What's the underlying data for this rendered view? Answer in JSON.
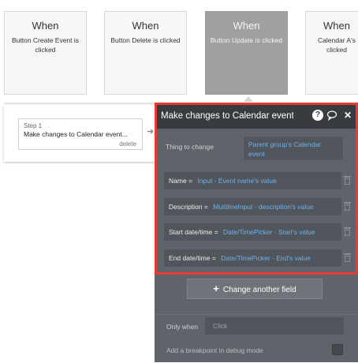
{
  "events": [
    {
      "when": "When",
      "description": "Button Create Event is clicked"
    },
    {
      "when": "When",
      "description": "Button Delete is clicked"
    },
    {
      "when": "When",
      "description": "Button Update is clicked"
    },
    {
      "when": "When",
      "description": "Calendar A's",
      "description2": "clicked"
    }
  ],
  "step": {
    "number": "Step 1",
    "name": "Make changes to Calendar event...",
    "delete_label": "delete"
  },
  "editor": {
    "title": "Make changes to Calendar event",
    "thing_label": "Thing to change",
    "thing_value": "Parent group's Calendar event",
    "fields": [
      {
        "name": "Name",
        "equals": "=",
        "value": "Input - Event name's value"
      },
      {
        "name": "Description",
        "equals": "=",
        "value": "MultilineInput - description's value"
      },
      {
        "name": "Start date/time",
        "equals": "=",
        "value": "Date/TimePicker - Start's value"
      },
      {
        "name": "End date/time",
        "equals": "=",
        "value": "Date/TimePicker - End's value"
      }
    ],
    "add_field_label": "Change another field",
    "only_when_label": "Only when",
    "only_when_placeholder": "Click",
    "debug_label": "Add a breakpoint in debug mode"
  },
  "icons": {
    "help": "question-icon",
    "comment": "comment-icon",
    "close": "close-icon",
    "trash": "trash-icon",
    "plus": "plus-icon"
  },
  "colors": {
    "highlight": "#e53b30",
    "link_value": "#6fb0ee",
    "editor_bg": "#5e6469",
    "editor_header": "#383c40"
  }
}
